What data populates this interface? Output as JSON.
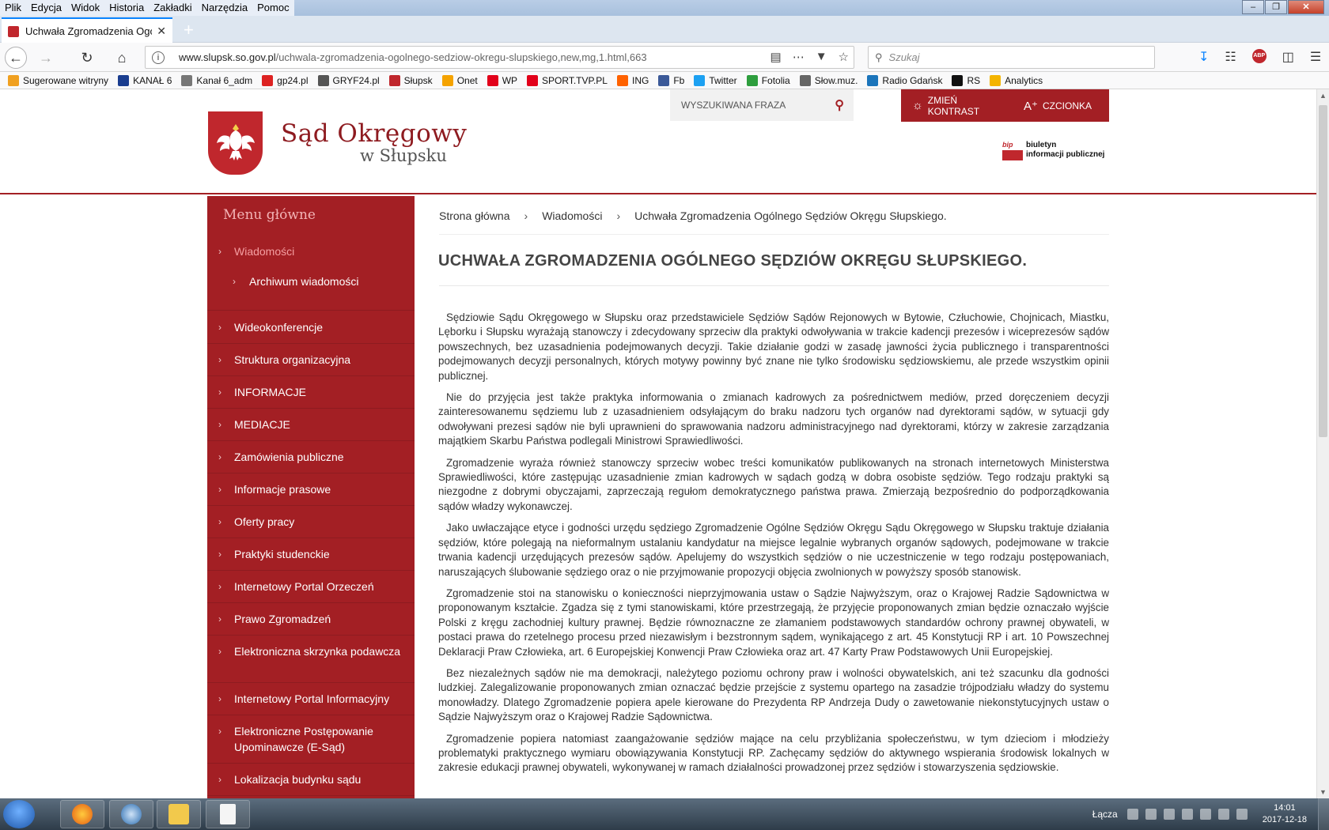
{
  "browser": {
    "menu": [
      "Plik",
      "Edycja",
      "Widok",
      "Historia",
      "Zakładki",
      "Narzędzia",
      "Pomoc"
    ],
    "tab_title": "Uchwała Zgromadzenia Ogólnego",
    "url_host": "www.slupsk.so.gov.pl",
    "url_path": "/uchwala-zgromadzenia-ogolnego-sedziow-okregu-slupskiego,new,mg,1.html,663",
    "search_placeholder": "Szukaj",
    "bookmarks": [
      {
        "label": "Sugerowane witryny",
        "color": "#f0a020"
      },
      {
        "label": "KANAŁ 6",
        "color": "#1a3d8f"
      },
      {
        "label": "Kanał 6_adm",
        "color": "#777777"
      },
      {
        "label": "gp24.pl",
        "color": "#d22"
      },
      {
        "label": "GRYF24.pl",
        "color": "#555555"
      },
      {
        "label": "Słupsk",
        "color": "#c0272d"
      },
      {
        "label": "Onet",
        "color": "#f5a300"
      },
      {
        "label": "WP",
        "color": "#e2001a"
      },
      {
        "label": "SPORT.TVP.PL",
        "color": "#e2001a"
      },
      {
        "label": "ING",
        "color": "#ff6200"
      },
      {
        "label": "Fb",
        "color": "#3b5998"
      },
      {
        "label": "Twitter",
        "color": "#1da1f2"
      },
      {
        "label": "Fotolia",
        "color": "#2e9e3e"
      },
      {
        "label": "Słow.muz.",
        "color": "#666666"
      },
      {
        "label": "Radio Gdańsk",
        "color": "#1b75bb"
      },
      {
        "label": "RS",
        "color": "#111111"
      },
      {
        "label": "Analytics",
        "color": "#f4b400"
      }
    ]
  },
  "site": {
    "name": "Sąd Okręgowy",
    "subname": "w Słupsku",
    "search_placeholder": "WYSZUKIWANA FRAZA",
    "contrast_label": "ZMIEŃ KONTRAST",
    "font_label": "CZCIONKA",
    "bip_tag": "bip",
    "bip_line1": "biuletyn",
    "bip_line2": "informacji publicznej",
    "accent_color": "#a31f24"
  },
  "menu": {
    "title": "Menu główne",
    "items": [
      {
        "label": "Wiadomości",
        "active": true
      },
      {
        "label": "Archiwum wiadomości",
        "sub": true
      },
      {
        "label": "Wideokonferencje"
      },
      {
        "label": "Struktura organizacyjna"
      },
      {
        "label": "INFORMACJE"
      },
      {
        "label": "MEDIACJE"
      },
      {
        "label": "Zamówienia publiczne"
      },
      {
        "label": "Informacje prasowe"
      },
      {
        "label": "Oferty pracy"
      },
      {
        "label": "Praktyki studenckie"
      },
      {
        "label": "Internetowy Portal Orzeczeń"
      },
      {
        "label": "Prawo Zgromadzeń"
      },
      {
        "label": "Elektroniczna skrzynka podawcza"
      },
      {
        "label": "Internetowy Portal Informacyjny"
      },
      {
        "label": "Elektroniczne Postępowanie Upominawcze (E-Sąd)"
      },
      {
        "label": "Lokalizacja budynku sądu"
      }
    ]
  },
  "breadcrumb": [
    "Strona główna",
    "Wiadomości",
    "Uchwała Zgromadzenia Ogólnego Sędziów Okręgu Słupskiego."
  ],
  "article": {
    "title": "UCHWAŁA ZGROMADZENIA OGÓLNEGO SĘDZIÓW OKRĘGU SŁUPSKIEGO.",
    "paragraphs": [
      "Sędziowie Sądu Okręgowego w Słupsku oraz przedstawiciele Sędziów Sądów Rejonowych w Bytowie, Człuchowie, Chojnicach, Miastku, Lęborku i Słupsku wyrażają stanowczy i zdecydowany sprzeciw dla praktyki odwoływania w trakcie kadencji prezesów i wiceprezesów sądów powszechnych, bez uzasadnienia podejmowanych decyzji. Takie działanie godzi w zasadę jawności życia publicznego i transparentności podejmowanych decyzji personalnych, których motywy powinny być znane nie tylko środowisku sędziowskiemu, ale przede wszystkim opinii publicznej.",
      "Nie do przyjęcia jest także praktyka informowania o zmianach kadrowych za pośrednictwem mediów, przed doręczeniem decyzji zainteresowanemu sędziemu lub z uzasadnieniem odsyłającym do braku nadzoru tych organów nad dyrektorami sądów, w sytuacji gdy odwoływani prezesi sądów nie byli uprawnieni do sprawowania nadzoru administracyjnego nad dyrektorami, którzy w zakresie zarządzania majątkiem Skarbu Państwa podlegali Ministrowi Sprawiedliwości.",
      "Zgromadzenie wyraża również stanowczy sprzeciw wobec treści komunikatów publikowanych na stronach internetowych Ministerstwa Sprawiedliwości, które zastępując uzasadnienie zmian kadrowych w sądach godzą w dobra osobiste sędziów. Tego rodzaju praktyki są niezgodne z dobrymi obyczajami, zaprzeczają regułom demokratycznego państwa prawa. Zmierzają bezpośrednio do podporządkowania sądów władzy wykonawczej.",
      "Jako uwłaczające etyce i godności urzędu sędziego Zgromadzenie Ogólne Sędziów Okręgu Sądu Okręgowego w Słupsku traktuje działania sędziów, które polegają na nieformalnym ustalaniu kandydatur na miejsce legalnie wybranych organów sądowych, podejmowane w trakcie trwania kadencji urzędujących prezesów sądów. Apelujemy do wszystkich sędziów o nie uczestniczenie w tego rodzaju postępowaniach, naruszających ślubowanie sędziego oraz o nie przyjmowanie propozycji objęcia zwolnionych w powyższy sposób stanowisk.",
      "Zgromadzenie stoi na stanowisku o konieczności nieprzyjmowania ustaw o Sądzie Najwyższym, oraz o Krajowej Radzie Sądownictwa w proponowanym kształcie. Zgadza się z tymi stanowiskami, które przestrzegają, że przyjęcie proponowanych zmian będzie oznaczało wyjście Polski z kręgu zachodniej kultury prawnej. Będzie równoznaczne ze złamaniem podstawowych standardów ochrony prawnej obywateli, w postaci prawa do rzetelnego procesu przed niezawisłym i bezstronnym sądem, wynikającego z art. 45 Konstytucji RP i art. 10 Powszechnej Deklaracji Praw Człowieka, art. 6 Europejskiej Konwencji Praw Człowieka oraz art. 47 Karty Praw Podstawowych Unii Europejskiej.",
      "Bez niezależnych sądów nie ma demokracji, należytego poziomu ochrony praw i wolności obywatelskich, ani też szacunku dla godności ludzkiej. Zalegalizowanie proponowanych zmian oznaczać będzie przejście z systemu opartego na zasadzie trójpodziału władzy do systemu monowładzy. Dlatego Zgromadzenie popiera apele kierowane do Prezydenta RP Andrzeja Dudy o zawetowanie niekonstytucyjnych ustaw o Sądzie Najwyższym oraz o Krajowej Radzie Sądownictwa.",
      "Zgromadzenie popiera natomiast zaangażowanie sędziów mające na celu przybliżania społeczeństwu, w tym dzieciom i młodzieży problematyki praktycznego wymiaru obowiązywania Konstytucji RP. Zachęcamy sędziów do aktywnego wspierania środowisk lokalnych w zakresie edukacji prawnej obywateli, wykonywanej w ramach działalności prowadzonej przez sędziów i stowarzyszenia sędziowskie."
    ]
  },
  "taskbar": {
    "network_label": "Łącza",
    "time": "14:01",
    "date": "2017-12-18"
  }
}
